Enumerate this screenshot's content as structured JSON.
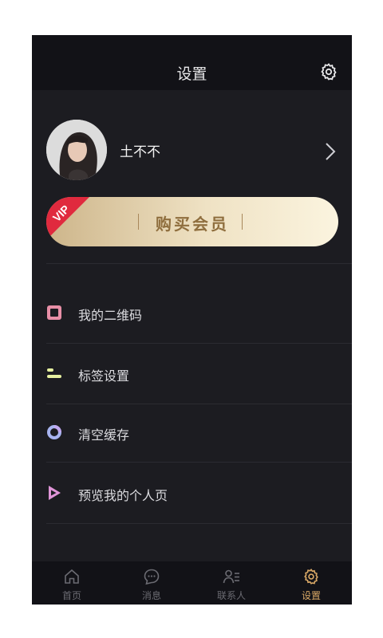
{
  "header": {
    "title": "设置",
    "settings_icon": "gear-icon"
  },
  "profile": {
    "name": "土不不",
    "avatar_icon": "avatar-photo",
    "chevron_icon": "chevron-right-icon"
  },
  "vip": {
    "badge": "VIP",
    "label": "购买会员"
  },
  "menu": {
    "items": [
      {
        "label": "我的二维码",
        "icon": "qrcode-square-icon",
        "color": "#e88fa7"
      },
      {
        "label": "标签设置",
        "icon": "tag-lines-icon",
        "color": "#e6f0a0"
      },
      {
        "label": "清空缓存",
        "icon": "ring-icon",
        "color": "#a8b4f0"
      },
      {
        "label": "预览我的个人页",
        "icon": "play-triangle-icon",
        "color": "#e095d8"
      }
    ]
  },
  "tabbar": {
    "items": [
      {
        "label": "首页",
        "icon": "home-icon"
      },
      {
        "label": "消息",
        "icon": "chat-icon"
      },
      {
        "label": "联系人",
        "icon": "contacts-icon"
      },
      {
        "label": "设置",
        "icon": "gear-icon",
        "active": true
      }
    ]
  },
  "colors": {
    "background": "#1c1c21",
    "header": "#121217",
    "accent": "#d9a866",
    "vip_red": "#e02a3e"
  }
}
